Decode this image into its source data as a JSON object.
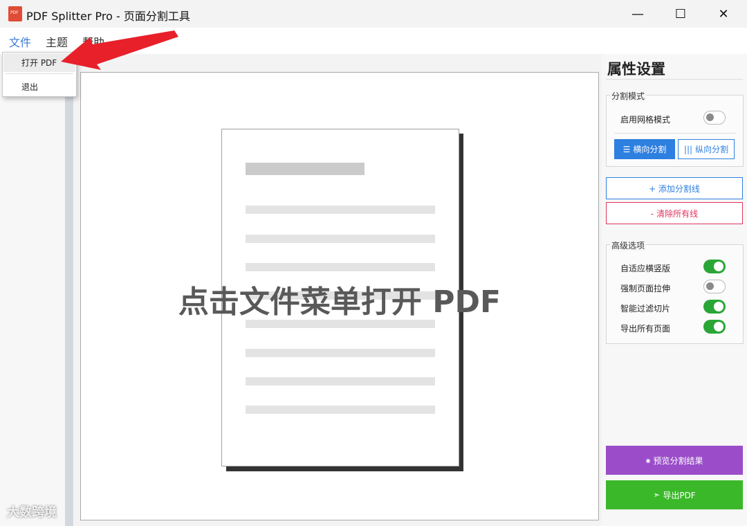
{
  "window": {
    "title": "PDF Splitter Pro - 页面分割工具",
    "app_icon_text": "PDF",
    "minimize_glyph": "—",
    "maximize_glyph": "☐",
    "close_glyph": "✕"
  },
  "menubar": {
    "file": "文件",
    "theme": "主题",
    "help": "帮助"
  },
  "file_menu": {
    "open_pdf": "打开 PDF",
    "exit": "退出"
  },
  "canvas": {
    "hint": "点击文件菜单打开 PDF"
  },
  "panel": {
    "title": "属性设置",
    "split_mode": {
      "legend": "分割模式",
      "grid_mode_label": "启用网格模式",
      "grid_mode_on": false,
      "horizontal_label": "横向分割",
      "horizontal_icon": "☰",
      "vertical_label": "纵向分割",
      "vertical_icon": "|||",
      "selected": "horizontal"
    },
    "add_line_label": "+ 添加分割线",
    "clear_lines_label": "- 清除所有线",
    "advanced": {
      "legend": "高级选项",
      "options": [
        {
          "label": "自适应横竖版",
          "on": true
        },
        {
          "label": "强制页面拉伸",
          "on": false
        },
        {
          "label": "智能过滤切片",
          "on": true
        },
        {
          "label": "导出所有页面",
          "on": true
        }
      ]
    },
    "preview_label": "预览分割结果",
    "preview_icon": "◉",
    "export_label": "导出PDF",
    "export_icon": "➣"
  },
  "watermark": "大数跨境",
  "colors": {
    "accent_blue": "#2d7fe0",
    "danger": "#e0335e",
    "preview_purple": "#9b4dc9",
    "export_green": "#3bb82a",
    "annotation_arrow": "#e8202a"
  }
}
